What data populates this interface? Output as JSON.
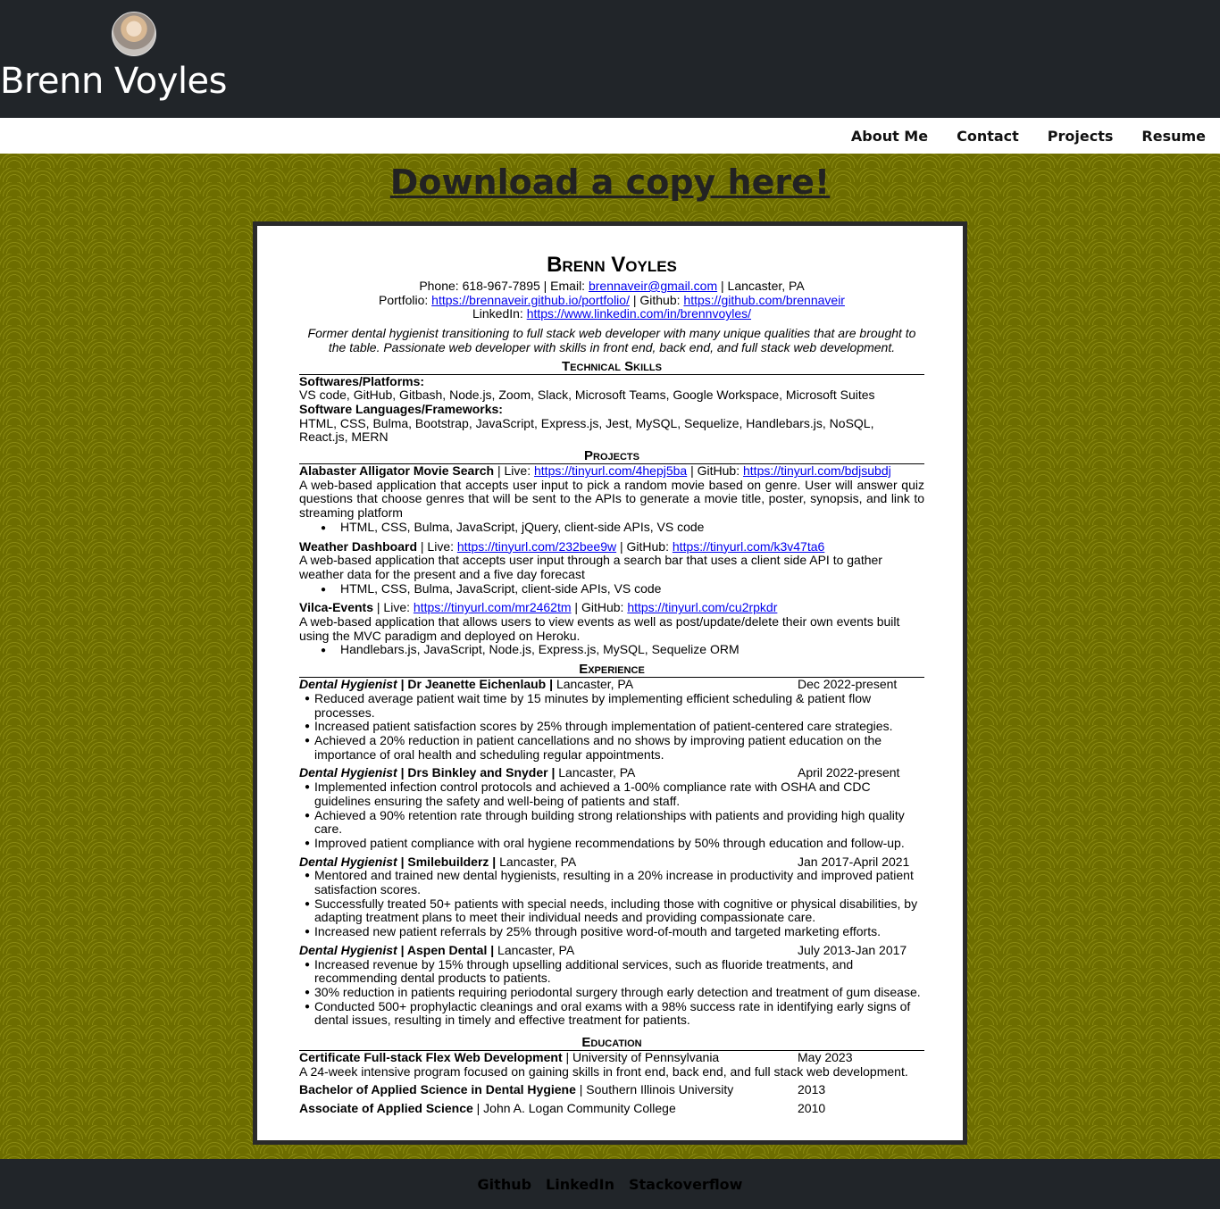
{
  "header": {
    "title": "Brenn Voyles"
  },
  "nav": {
    "about": "About Me",
    "contact": "Contact",
    "projects": "Projects",
    "resume": "Resume"
  },
  "download": {
    "label": "Download a copy here!"
  },
  "resume": {
    "name": "Brenn Voyles",
    "phone_email_prefix": "Phone: 618-967-7895 | Email: ",
    "email": "brennaveir@gmail.com",
    "location_suffix": " | Lancaster, PA",
    "portfolio_prefix": "Portfolio: ",
    "portfolio_url": "https://brennaveir.github.io/portfolio/",
    "github_prefix": " | Github: ",
    "github_url": "https://github.com/brennaveir",
    "linkedin_prefix": "LinkedIn: ",
    "linkedin_url": "https://www.linkedin.com/in/brennvoyles/",
    "summary": "Former dental hygienist transitioning to full stack web developer with many unique qualities that are brought to the table. Passionate web developer with skills in front end, back end, and full stack web development.",
    "sections": {
      "skills": "Technical Skills",
      "projects": "Projects",
      "experience": "Experience",
      "education": "Education"
    },
    "skills": {
      "platforms_label": "Softwares/Platforms:",
      "platforms": "VS code, GitHub, Gitbash, Node.js, Zoom, Slack, Microsoft Teams, Google Workspace, Microsoft Suites",
      "languages_label": "Software Languages/Frameworks:",
      "languages": "HTML, CSS, Bulma, Bootstrap, JavaScript, Express.js, Jest, MySQL, Sequelize, Handlebars.js, NoSQL, React.js, MERN"
    },
    "projects": [
      {
        "name": "Alabaster Alligator Movie Search",
        "live_prefix": " | Live: ",
        "live": "https://tinyurl.com/4hepj5ba",
        "gh_prefix": " | GitHub: ",
        "gh": "https://tinyurl.com/bdjsubdj",
        "desc": "A web-based application that accepts user input to pick a random movie based on genre. User will answer quiz questions that choose genres that will be sent to the APIs to generate a movie title, poster, synopsis, and link to streaming platform",
        "tech": "HTML, CSS, Bulma, JavaScript, jQuery, client-side APIs, VS code"
      },
      {
        "name": "Weather Dashboard",
        "live_prefix": " | Live: ",
        "live": "https://tinyurl.com/232bee9w",
        "gh_prefix": " | GitHub: ",
        "gh": "https://tinyurl.com/k3v47ta6",
        "desc": "A web-based application that accepts user input through a search bar that uses a client side API to gather weather data for the present and a five day forecast",
        "tech": "HTML, CSS, Bulma, JavaScript, client-side APIs, VS code"
      },
      {
        "name": "Vilca-Events",
        "live_prefix": " | Live: ",
        "live": "https://tinyurl.com/mr2462tm",
        "gh_prefix": " | GitHub: ",
        "gh": "https://tinyurl.com/cu2rpkdr",
        "desc": "A web-based application that allows users to view events as well as post/update/delete their own events built using the MVC paradigm and deployed on Heroku.",
        "tech": "Handlebars.js, JavaScript, Node.js, Express.js, MySQL, Sequelize ORM"
      }
    ],
    "jobs": [
      {
        "role": "Dental Hygienist",
        "employer": " | Dr Jeanette Eichenlaub | ",
        "place": "Lancaster, PA",
        "date": "Dec 2022-present",
        "bullets": [
          "Reduced average patient wait time by 15 minutes by implementing efficient scheduling & patient flow processes.",
          "Increased patient satisfaction scores by 25% through implementation of patient-centered care strategies.",
          "Achieved a 20% reduction in patient cancellations and no shows by improving patient education on the importance of oral health and scheduling regular appointments."
        ]
      },
      {
        "role": "Dental Hygienist",
        "employer": " | Drs Binkley and Snyder | ",
        "place": "Lancaster, PA",
        "date": "April 2022-present",
        "bullets": [
          "Implemented infection control protocols and achieved a 1-00% compliance rate with OSHA and CDC guidelines ensuring the safety and well-being of patients and staff.",
          "Achieved a 90% retention rate through building strong relationships with patients and providing high quality care.",
          "Improved patient compliance with oral hygiene recommendations by 50% through education and follow-up."
        ]
      },
      {
        "role": "Dental Hygienist",
        "employer": " | Smilebuilderz | ",
        "place": "Lancaster, PA",
        "date": "Jan 2017-April 2021",
        "bullets": [
          "Mentored and trained new dental hygienists, resulting in a 20% increase in productivity and improved patient satisfaction scores.",
          "Successfully treated 50+ patients with special needs, including those with cognitive or physical disabilities, by adapting treatment plans to meet their individual needs and providing compassionate care.",
          "Increased new patient referrals by 25% through positive word-of-mouth and targeted marketing efforts."
        ]
      },
      {
        "role": "Dental Hygienist",
        "employer": " | Aspen Dental | ",
        "place": "Lancaster, PA",
        "date": "July 2013-Jan 2017",
        "bullets": [
          "Increased revenue by 15% through upselling additional services, such as fluoride treatments, and recommending dental products to patients.",
          "30% reduction in patients requiring periodontal surgery through early detection and treatment of gum disease.",
          "Conducted 500+ prophylactic cleanings and oral exams with a 98% success rate in identifying early signs of dental issues, resulting in timely and effective treatment for patients."
        ]
      }
    ],
    "education": [
      {
        "degree": "Certificate Full-stack Flex Web Development",
        "school": " | University of Pennsylvania",
        "date": "May 2023",
        "desc": "A 24-week intensive program focused on gaining skills in front end, back end, and full stack web development."
      },
      {
        "degree": "Bachelor of Applied Science in Dental Hygiene",
        "school": " | Southern Illinois University",
        "date": "2013",
        "desc": ""
      },
      {
        "degree": "Associate of Applied Science",
        "school": " | John A. Logan Community College",
        "date": "2010",
        "desc": ""
      }
    ]
  },
  "footer": {
    "github": "Github",
    "linkedin": "LinkedIn",
    "stackoverflow": "Stackoverflow"
  }
}
